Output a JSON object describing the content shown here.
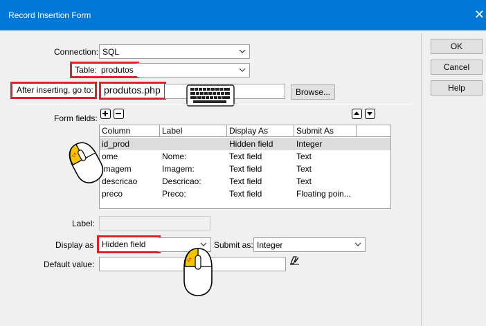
{
  "dialog": {
    "title": "Record Insertion Form"
  },
  "connection": {
    "label": "Connection:",
    "value": "SQL"
  },
  "table": {
    "label": "Table:",
    "value": "produtos"
  },
  "after_insert": {
    "label": "After inserting, go to:",
    "value": "produtos.php",
    "browse_label": "Browse..."
  },
  "form_fields": {
    "label": "Form fields:",
    "columns": [
      "Column",
      "Label",
      "Display As",
      "Submit As"
    ],
    "rows": [
      {
        "column": "id_prod",
        "label": "",
        "display": "Hidden field",
        "submit": "Integer"
      },
      {
        "column": "ome",
        "label": "Nome:",
        "display": "Text field",
        "submit": "Text"
      },
      {
        "column": "imagem",
        "label": "Imagem:",
        "display": "Text field",
        "submit": "Text"
      },
      {
        "column": "descricao",
        "label": "Descricao:",
        "display": "Text field",
        "submit": "Text"
      },
      {
        "column": "preco",
        "label": "Preco:",
        "display": "Text field",
        "submit": "Floating poin..."
      }
    ]
  },
  "label_field": {
    "label": "Label:"
  },
  "display_as": {
    "label": "Display as",
    "value": "Hidden field"
  },
  "submit_as": {
    "label": "Submit as:",
    "value": "Integer"
  },
  "default_value": {
    "label": "Default value:"
  },
  "buttons": {
    "ok": "OK",
    "cancel": "Cancel",
    "help": "Help"
  },
  "colors": {
    "titlebar": "#0078d7",
    "highlight": "#e0202a",
    "mouse_button": "#f5c400"
  }
}
